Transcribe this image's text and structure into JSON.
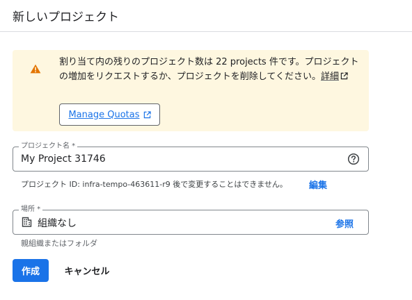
{
  "page": {
    "title": "新しいプロジェクト"
  },
  "warning": {
    "message": "割り当て内の残りのプロジェクト数は 22 projects 件です。プロジェクトの増加をリクエストするか、プロジェクトを削除してください。",
    "detail_link": "詳細",
    "quota_button": "Manage Quotas",
    "icon": "warning-icon",
    "color": "#e37400"
  },
  "project_name": {
    "label": "プロジェクト名 *",
    "value": "My Project 31746",
    "help_icon": "help-circle-icon",
    "id_hint": "プロジェクト ID: infra-tempo-463611-r9 後で変更することはできません。",
    "edit_link": "編集"
  },
  "location": {
    "label": "場所 *",
    "value": "組織なし",
    "icon": "organization-icon",
    "browse_link": "参照",
    "hint": "親組織またはフォルダ"
  },
  "actions": {
    "create": "作成",
    "cancel": "キャンセル"
  },
  "colors": {
    "primary": "#1a73e8",
    "warning_bg": "#fef7e0"
  }
}
